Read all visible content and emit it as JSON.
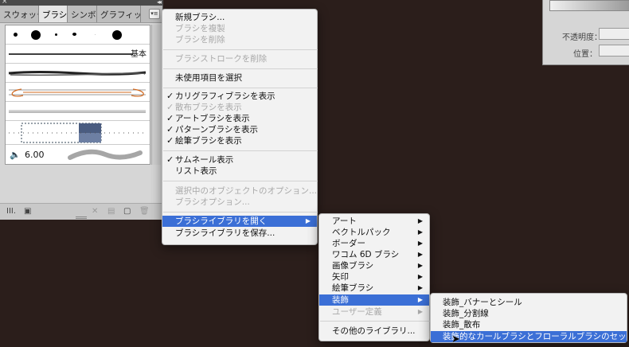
{
  "panel": {
    "tabs": [
      "スウォッチ",
      "ブラシ",
      "シンボル",
      "グラフィック"
    ],
    "basic_label": "基本",
    "calligraphic_size": "6.00"
  },
  "right_panel": {
    "opacity_label": "不透明度：",
    "position_label": "位置："
  },
  "main_menu": {
    "new_brush": "新規ブラシ...",
    "duplicate": "ブラシを複製",
    "delete": "ブラシを削除",
    "remove_stroke": "ブラシストロークを削除",
    "select_unused": "未使用項目を選択",
    "show_calligraphic": "カリグラフィブラシを表示",
    "show_scatter": "散布ブラシを表示",
    "show_art": "アートブラシを表示",
    "show_pattern": "パターンブラシを表示",
    "show_bristle": "絵筆ブラシを表示",
    "thumbnail_view": "サムネール表示",
    "list_view": "リスト表示",
    "options_selected": "選択中のオブジェクトのオプション...",
    "brush_options": "ブラシオプション...",
    "open_library": "ブラシライブラリを開く",
    "save_library": "ブラシライブラリを保存..."
  },
  "library_menu": {
    "items": [
      "アート",
      "ベクトルパック",
      "ボーダー",
      "ワコム 6D ブラシ",
      "画像ブラシ",
      "矢印",
      "絵筆ブラシ",
      "装飾",
      "ユーザー定義"
    ],
    "other_library": "その他のライブラリ..."
  },
  "decor_menu": {
    "items": [
      "装飾_バナーとシール",
      "装飾_分割線",
      "装飾_散布",
      "装飾的なカールブラシとフローラルブラシのセット"
    ]
  },
  "colors": {
    "highlight": "#3b6fd6",
    "background": "#2b1e1b"
  }
}
